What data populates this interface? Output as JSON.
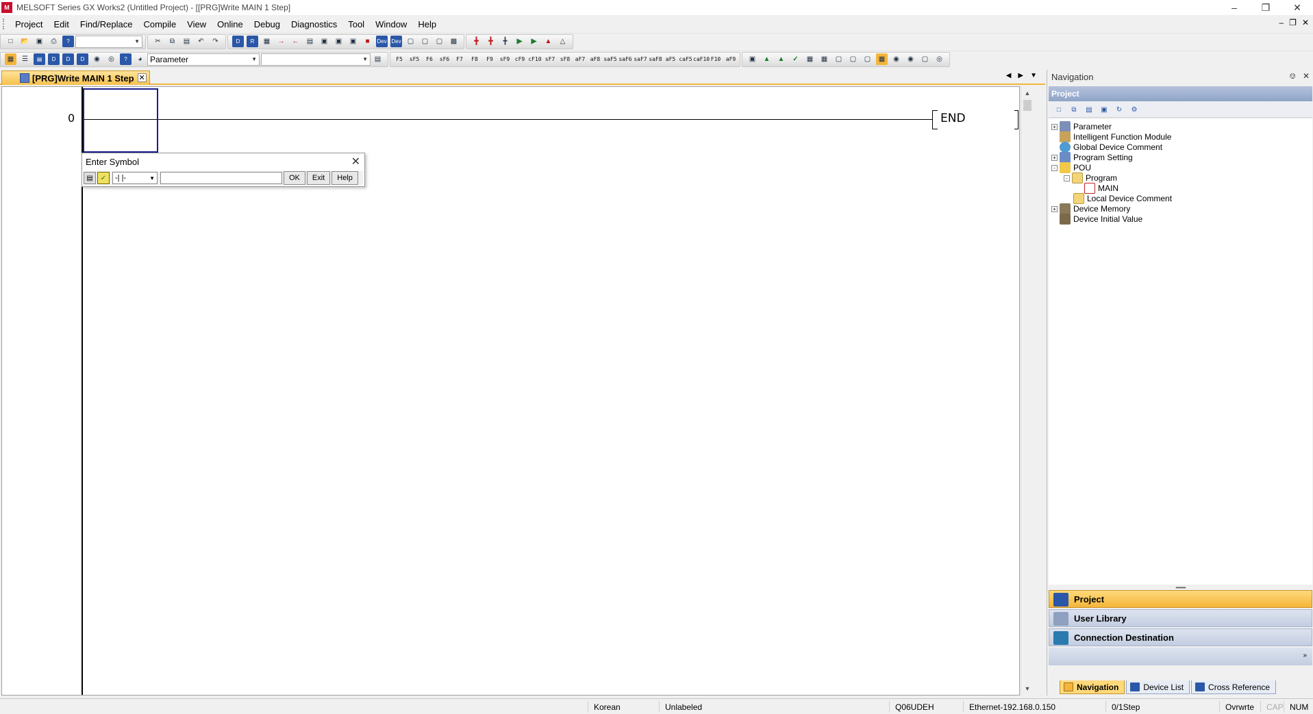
{
  "window": {
    "title": "MELSOFT Series GX Works2 (Untitled Project) - [[PRG]Write MAIN 1 Step]",
    "app_icon": "melsoft-logo-icon",
    "controls": [
      "minimize-icon",
      "restore-icon",
      "close-icon"
    ]
  },
  "menu": {
    "items": [
      "Project",
      "Edit",
      "Find/Replace",
      "Compile",
      "View",
      "Online",
      "Debug",
      "Diagnostics",
      "Tool",
      "Window",
      "Help"
    ]
  },
  "toolbar2": {
    "parameter_combo": "Parameter",
    "function_keys": [
      "F5",
      "sF5",
      "F6",
      "sF6",
      "F7",
      "F8",
      "F9",
      "sF9",
      "cF9",
      "cF10",
      "sF7",
      "sF8",
      "aF7",
      "aF8",
      "saF5",
      "saF6",
      "saF7",
      "saF8",
      "aF5",
      "caF5",
      "caF10",
      "F10",
      "aF9"
    ]
  },
  "editor": {
    "tab_label": "[PRG]Write MAIN 1 Step",
    "step_number": "0",
    "end_label": "END"
  },
  "enter_symbol": {
    "title": "Enter Symbol",
    "symbol_type": "-| |-",
    "input_value": "",
    "ok_label": "OK",
    "exit_label": "Exit",
    "help_label": "Help"
  },
  "navigation": {
    "header": "Navigation",
    "section_title": "Project",
    "tree": [
      {
        "label": "Parameter",
        "expander": "+",
        "icon": "parameter-icon"
      },
      {
        "label": "Intelligent Function Module",
        "expander": "",
        "icon": "intelligent-module-icon"
      },
      {
        "label": "Global Device Comment",
        "expander": "",
        "icon": "global-comment-icon"
      },
      {
        "label": "Program Setting",
        "expander": "+",
        "icon": "program-setting-icon"
      },
      {
        "label": "POU",
        "expander": "-",
        "icon": "pou-folder-icon"
      },
      {
        "label": "Program",
        "expander": "-",
        "icon": "folder-icon"
      },
      {
        "label": "MAIN",
        "expander": "",
        "icon": "ladder-program-icon"
      },
      {
        "label": "Local Device Comment",
        "expander": "",
        "icon": "local-comment-icon"
      },
      {
        "label": "Device Memory",
        "expander": "+",
        "icon": "device-memory-icon"
      },
      {
        "label": "Device Initial Value",
        "expander": "",
        "icon": "device-initial-icon"
      }
    ],
    "sections": [
      {
        "label": "Project",
        "active": true
      },
      {
        "label": "User Library",
        "active": false
      },
      {
        "label": "Connection Destination",
        "active": false
      }
    ],
    "bottom_tabs": [
      {
        "label": "Navigation",
        "active": true
      },
      {
        "label": "Device List",
        "active": false
      },
      {
        "label": "Cross Reference",
        "active": false
      }
    ]
  },
  "status": {
    "language": "Korean",
    "label_mode": "Unlabeled",
    "cpu": "Q06UDEH",
    "connection": "Ethernet-192.168.0.150",
    "steps": "0/1Step",
    "mode": "Ovrwrte",
    "caps": "CAP",
    "num": "NUM"
  },
  "colors": {
    "accent_orange": "#f4b53a",
    "header_blue": "#8fa4c8",
    "cursor_blue": "#1a1a8c"
  }
}
